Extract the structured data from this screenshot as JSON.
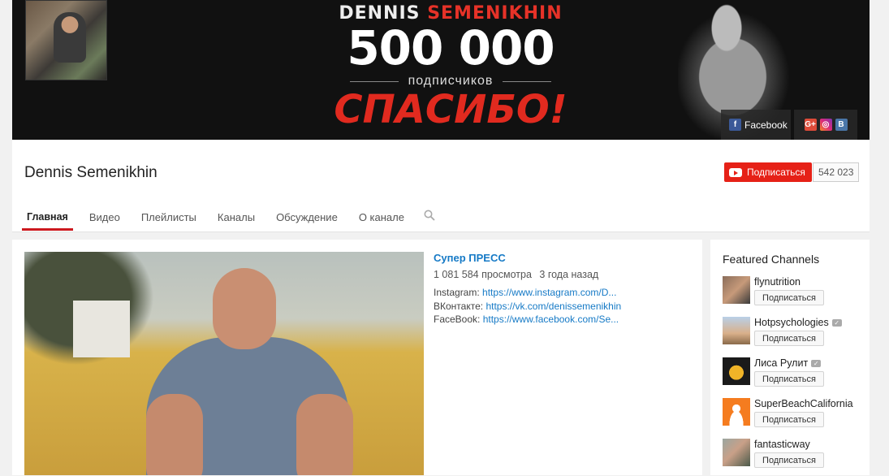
{
  "banner": {
    "name_part1": "DENNIS",
    "name_part2": "SEMENIKHIN",
    "count": "500 000",
    "subs_word": "подписчиков",
    "thanks": "СПАСИБО!",
    "social_facebook": "Facebook",
    "icons": [
      "facebook-icon",
      "google-plus-icon",
      "instagram-icon",
      "vk-icon"
    ]
  },
  "channel": {
    "title": "Dennis Semenikhin",
    "subscribe_label": "Подписаться",
    "subscriber_count": "542 023"
  },
  "tabs": [
    {
      "label": "Главная",
      "active": true
    },
    {
      "label": "Видео"
    },
    {
      "label": "Плейлисты"
    },
    {
      "label": "Каналы"
    },
    {
      "label": "Обсуждение"
    },
    {
      "label": "О канале"
    }
  ],
  "featured_video": {
    "title": "Супер ПРЕСС",
    "views": "1 081 584 просмотра",
    "age": "3 года назад",
    "description": [
      {
        "label": "Instagram:",
        "link": "https://www.instagram.com/D..."
      },
      {
        "label": "ВКонтакте:",
        "link": "https://vk.com/denissemenikhin"
      },
      {
        "label": "FaceBook:",
        "link": "https://www.facebook.com/Se..."
      }
    ]
  },
  "featured_channels": {
    "title": "Featured Channels",
    "subscribe_label": "Подписаться",
    "items": [
      {
        "name": "flynutrition",
        "verified": false
      },
      {
        "name": "Hotpsychologies",
        "verified": true
      },
      {
        "name": "Лиса Рулит",
        "verified": true
      },
      {
        "name": "SuperBeachCalifornia",
        "verified": false
      },
      {
        "name": "fantasticway",
        "verified": false
      }
    ]
  },
  "colors": {
    "accent_red": "#e62117",
    "link_blue": "#167ac6"
  }
}
